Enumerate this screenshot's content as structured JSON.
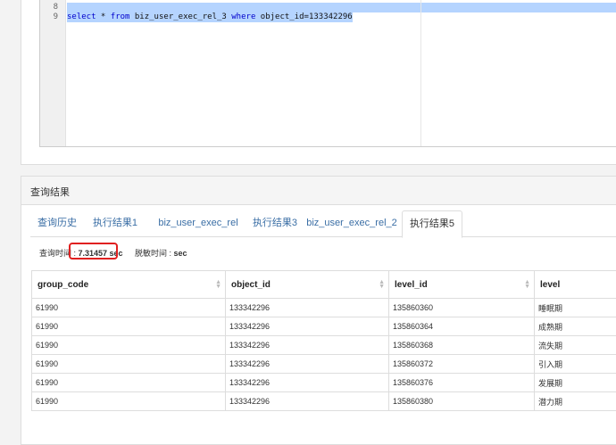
{
  "editor": {
    "lines": [
      {
        "number": "8",
        "text": ""
      },
      {
        "number": "9",
        "parts": {
          "kw1": "select",
          "star": " * ",
          "kw2": "from",
          "table": " biz_user_exec_rel_3 ",
          "kw3": "where",
          "cond": " object_id=133342296"
        }
      }
    ]
  },
  "results": {
    "title": "查询结果",
    "tabs": [
      "查询历史",
      "执行结果1",
      "biz_user_exec_rel",
      "执行结果3",
      "biz_user_exec_rel_2",
      "执行结果5"
    ],
    "active_tab": 5,
    "query_time_label": "查询时间 : ",
    "query_time_value": "7.31457 sec",
    "mask_time_label": "脱敏时间 : ",
    "mask_time_value": "sec",
    "columns": [
      "group_code",
      "object_id",
      "level_id",
      "level"
    ],
    "rows": [
      [
        "61990",
        "133342296",
        "135860360",
        "睡眠期"
      ],
      [
        "61990",
        "133342296",
        "135860364",
        "成熟期"
      ],
      [
        "61990",
        "133342296",
        "135860368",
        "流失期"
      ],
      [
        "61990",
        "133342296",
        "135860372",
        "引入期"
      ],
      [
        "61990",
        "133342296",
        "135860376",
        "发展期"
      ],
      [
        "61990",
        "133342296",
        "135860380",
        "潜力期"
      ]
    ]
  },
  "colors": {
    "link": "#3a6ea5",
    "selection": "#b5d4ff",
    "highlight_box": "#e02020"
  }
}
